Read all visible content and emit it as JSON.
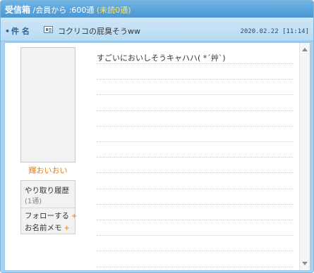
{
  "header": {
    "box_label": "受信箱",
    "count_text": " /会員から :600通 ",
    "unread_text": "(未読0通)"
  },
  "subject": {
    "label": "件 名",
    "bullet": "•",
    "text": "コクリコの屁臭そうww",
    "date": "2020.02.22 [11:14]"
  },
  "sender": {
    "nickname": "輝おいおい",
    "history_label": "やり取り履歴",
    "history_count": "(1通)",
    "follow_label": "フォローする",
    "memo_label": "お名前メモ",
    "plus": "+"
  },
  "message": {
    "body": "すごいにおいしそうキャハハ( *´艸`)"
  },
  "icons": {
    "mail": "mail-icon",
    "scroll_up": "scroll-up-arrow-icon",
    "scroll_down": "scroll-down-arrow-icon"
  },
  "colors": {
    "header_bg": "#4a97d3",
    "unread": "#ffe566",
    "nickname": "#f07c00",
    "plus": "#f07c00"
  }
}
